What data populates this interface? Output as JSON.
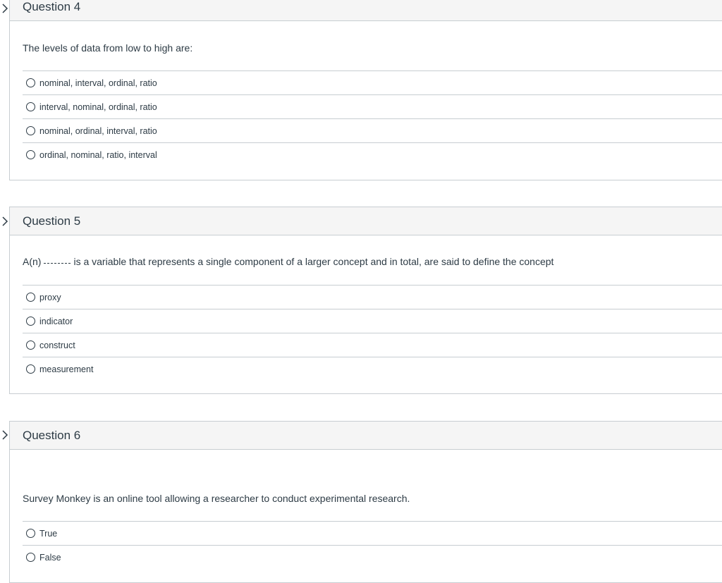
{
  "questions": [
    {
      "title": "Question 4",
      "text": "The levels of data from low to high are:",
      "answers": [
        "nominal, interval, ordinal, ratio",
        "interval, nominal, ordinal, ratio",
        "nominal, ordinal, interval, ratio",
        "ordinal, nominal, ratio, interval"
      ]
    },
    {
      "title": "Question 5",
      "text_prefix": "A(n)",
      "text_suffix": "is a variable that represents a single component of a larger concept and in total, are said to define the concept",
      "answers": [
        "proxy",
        "indicator",
        "construct",
        "measurement"
      ]
    },
    {
      "title": "Question 6",
      "text": "Survey Monkey is an online tool allowing a researcher to conduct experimental research.",
      "answers": [
        "True",
        "False"
      ]
    }
  ]
}
